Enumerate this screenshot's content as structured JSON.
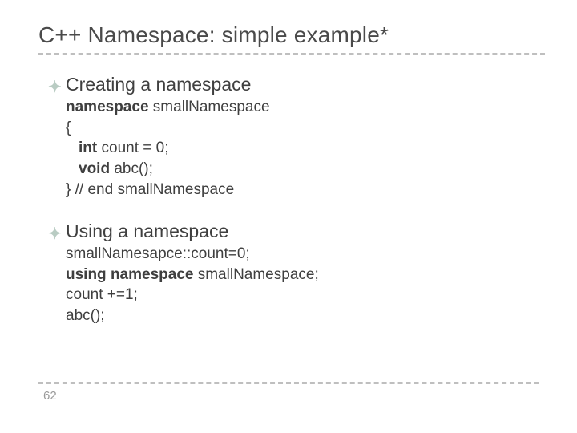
{
  "title": "C++ Namespace: simple example*",
  "bullets": [
    {
      "heading": "Creating a namespace",
      "code": {
        "l1_pre": "namespace ",
        "l1_post": "smallNamespace",
        "l2": "{",
        "l3_pre": "int ",
        "l3_post": "count = 0;",
        "l4_pre": "void ",
        "l4_post": "abc();",
        "l5": "} // end smallNamespace"
      }
    },
    {
      "heading": "Using a namespace",
      "code": {
        "l1": "smallNamesapce::count=0;",
        "l2_pre": "using namespace ",
        "l2_post": "smallNamespace;",
        "l3": "count +=1;",
        "l4": "abc();"
      }
    }
  ],
  "page_number": "62",
  "bullet_glyph": "✦"
}
